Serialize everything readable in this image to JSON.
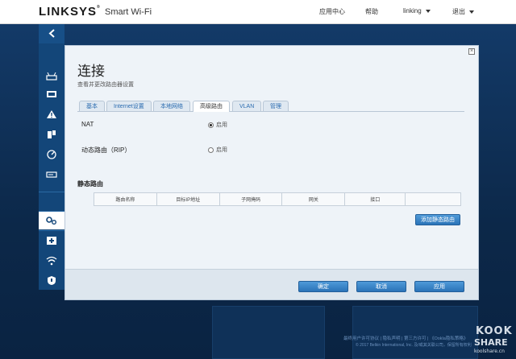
{
  "header": {
    "brand": "LINKSYS",
    "product": "Smart Wi-Fi",
    "nav": {
      "app_center": "应用中心",
      "help": "帮助",
      "user": "linking",
      "logout": "退出"
    }
  },
  "sidebar": {
    "items": [
      {
        "icon": "router-icon"
      },
      {
        "icon": "devices-icon"
      },
      {
        "icon": "alert-icon"
      },
      {
        "icon": "parental-icon"
      },
      {
        "icon": "speed-icon"
      },
      {
        "icon": "storage-icon"
      },
      {
        "icon": "settings-gear-icon"
      },
      {
        "icon": "diagnostics-icon"
      },
      {
        "icon": "wifi-icon"
      },
      {
        "icon": "security-shield-icon"
      }
    ]
  },
  "modal": {
    "title": "连接",
    "subtitle": "查看并更改路由器设置",
    "tabs": [
      {
        "label": "基本"
      },
      {
        "label": "Internet设置"
      },
      {
        "label": "本地网络"
      },
      {
        "label": "高级路由"
      },
      {
        "label": "VLAN"
      },
      {
        "label": "管理"
      }
    ],
    "nat": {
      "label": "NAT",
      "option": "启用"
    },
    "rip": {
      "label": "动态路由（RIP）",
      "option": "启用"
    },
    "static_routes": {
      "title": "静态路由",
      "columns": [
        "路由名称",
        "目标IP地址",
        "子网掩码",
        "网关",
        "接口",
        ""
      ],
      "add_button": "添加静态路由"
    },
    "buttons": {
      "ok": "确定",
      "cancel": "取消",
      "apply": "应用"
    }
  },
  "legal": {
    "links": "最终用户许可协议 | 隐私声明 | 第三方许可 | 《Ookla隐私策略》",
    "copyright": "© 2017 Belkin International, Inc. 及/或其关联公司，保留所有权利"
  },
  "watermark": {
    "line1": "KOOK",
    "line2": "SHARE",
    "site": "koolshare.cn"
  }
}
